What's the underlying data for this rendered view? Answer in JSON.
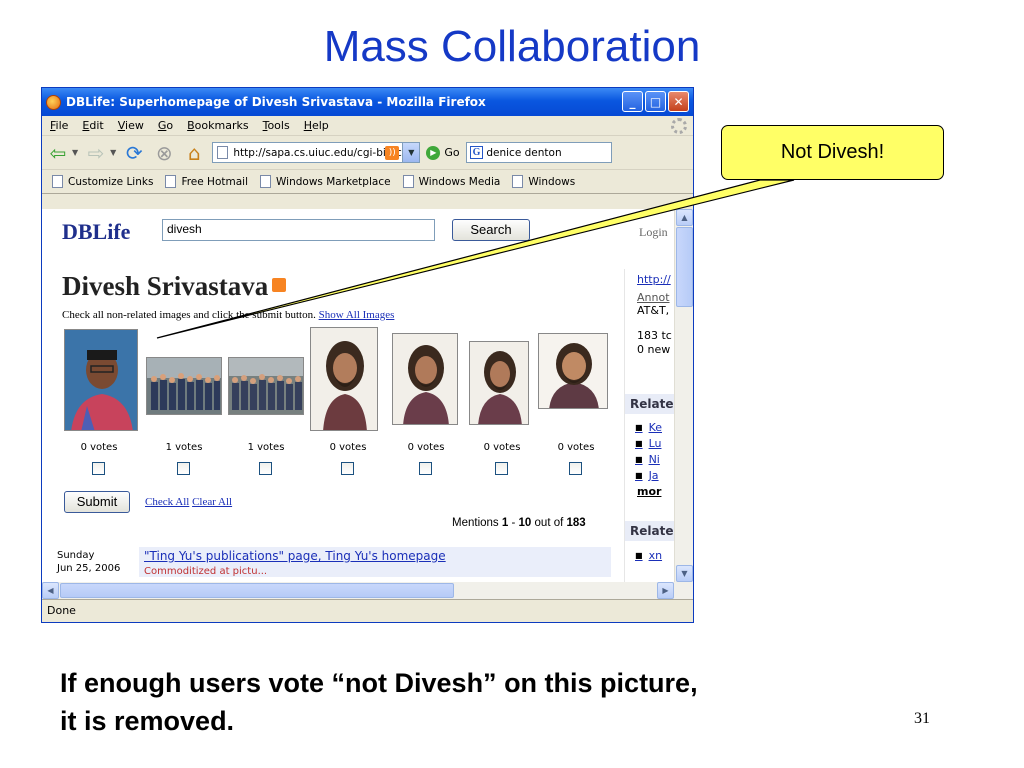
{
  "slide": {
    "title": "Mass Collaboration",
    "caption_line1": "If enough users vote “not Divesh” on this picture,",
    "caption_line2": "it is removed.",
    "page_number": "31",
    "callout": "Not Divesh!"
  },
  "browser": {
    "window_title": "DBLife: Superhomepage of Divesh Srivastava - Mozilla Firefox",
    "menu": [
      "File",
      "Edit",
      "View",
      "Go",
      "Bookmarks",
      "Tools",
      "Help"
    ],
    "url": "http://sapa.cs.uiuc.edu/cgi-bin/c",
    "go_label": "Go",
    "search_value": "denice denton",
    "bookmarks": [
      "Customize Links",
      "Free Hotmail",
      "Windows Marketplace",
      "Windows Media",
      "Windows"
    ],
    "status": "Done"
  },
  "page": {
    "logo": "DBLife",
    "search_value": "divesh",
    "search_button": "Search",
    "login": "Login",
    "person_name": "Divesh Srivastava",
    "instructions": "Check all non-related images and click the submit button.",
    "show_all_images": "Show All Images",
    "photos": [
      {
        "votes": "0 votes"
      },
      {
        "votes": "1 votes"
      },
      {
        "votes": "1 votes"
      },
      {
        "votes": "0 votes"
      },
      {
        "votes": "0 votes"
      },
      {
        "votes": "0 votes"
      },
      {
        "votes": "0 votes"
      }
    ],
    "submit": "Submit",
    "check_all": "Check All",
    "clear_all": "Clear All",
    "mentions_prefix": "Mentions",
    "mentions_from": "1",
    "mentions_dash": "-",
    "mentions_to": "10",
    "mentions_mid": "out of",
    "mentions_total": "183",
    "mention": {
      "day": "Sunday",
      "date": "Jun 25, 2006",
      "link": "\"Ting Yu's publications\" page, Ting Yu's homepage",
      "sub": "Commoditized at pictu..."
    },
    "right_column": {
      "link1": "http://",
      "annot": "Annot",
      "org": "AT&T,",
      "stat1": "183 tc",
      "stat2": "0 new",
      "related1": "Relate",
      "items": [
        "Ke",
        "Lu",
        "Ni",
        "Ja"
      ],
      "more": "mor",
      "related2": "Relate",
      "item_last": "xn"
    }
  }
}
